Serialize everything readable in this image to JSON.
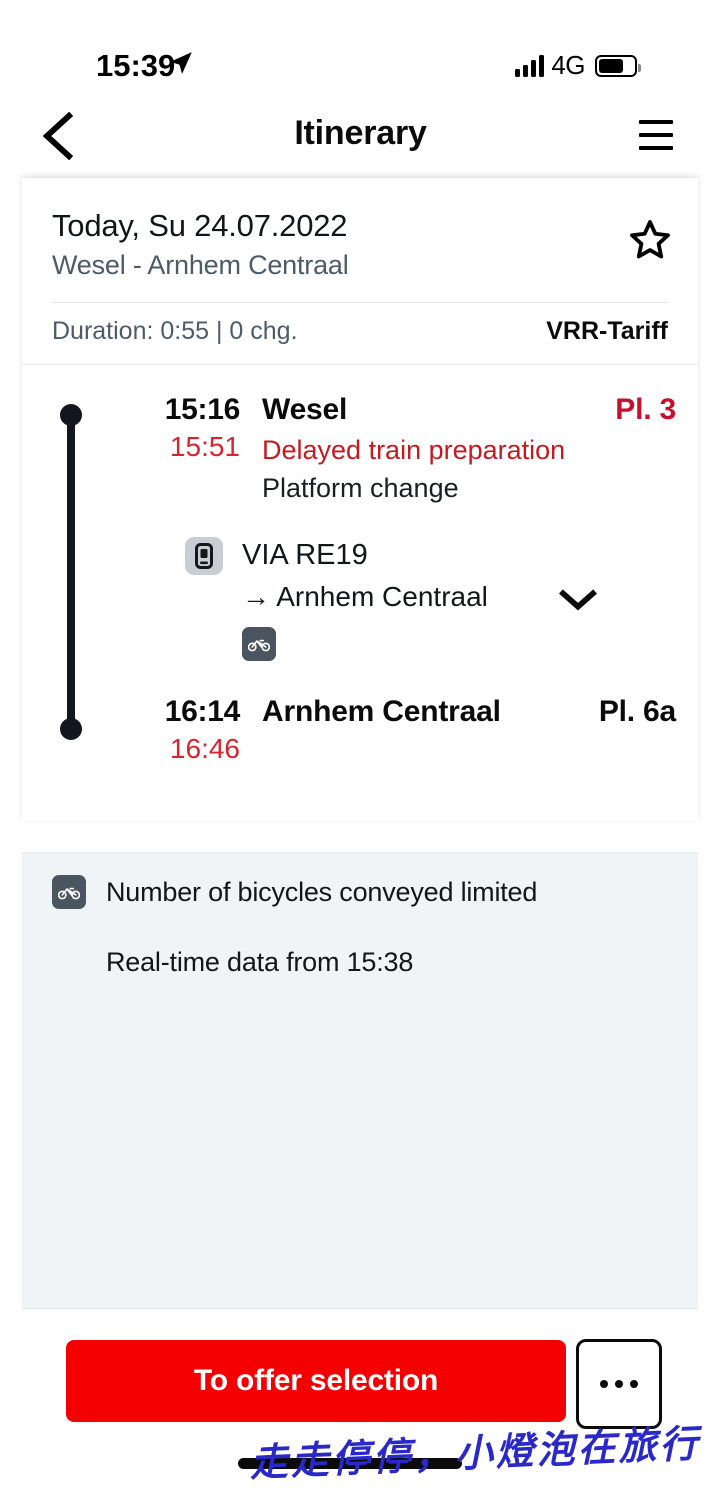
{
  "status_bar": {
    "time": "15:39",
    "location_icon": "location-arrow-icon",
    "network": "4G",
    "battery_level_pct": 62,
    "signal_bars": 4
  },
  "navbar": {
    "back_icon": "chevron-left-icon",
    "title": "Itinerary",
    "menu_icon": "hamburger-menu-icon"
  },
  "trip": {
    "date": "Today, Su 24.07.2022",
    "route": "Wesel - Arnhem Centraal",
    "favorite_icon": "star-outline-icon",
    "duration": "Duration: 0:55 | 0 chg.",
    "tariff": "VRR-Tariff"
  },
  "journey": {
    "departure": {
      "scheduled_time": "15:16",
      "realtime_time": "15:51",
      "station": "Wesel",
      "platform": "Pl. 3",
      "platform_delayed": true,
      "notes": [
        {
          "text": "Delayed train preparation",
          "style": "delay"
        },
        {
          "text": "Platform change",
          "style": "plain"
        }
      ]
    },
    "service": {
      "mode_icon": "train-mobile-icon",
      "line": "VIA RE19",
      "destination": "→ Arnhem Centraal",
      "expand_icon": "chevron-down-icon",
      "amenity_icon": "bicycle-icon"
    },
    "arrival": {
      "scheduled_time": "16:14",
      "realtime_time": "16:46",
      "station": "Arnhem Centraal",
      "platform": "Pl. 6a",
      "platform_delayed": false
    }
  },
  "info_panel": {
    "bicycle_icon": "bicycle-icon",
    "bicycle_note": "Number of bicycles conveyed limited",
    "realtime_note": "Real-time data from 15:38"
  },
  "actions": {
    "primary_label": "To offer selection",
    "more_icon": "ellipsis-icon"
  },
  "watermark": {
    "text": "走走停停，小燈泡在旅行"
  },
  "colors": {
    "accent_red": "#f50000",
    "delay_red": "#c8102e",
    "panel_bg": "#f1f4f6",
    "rail": "#14161f",
    "badge_dark": "#4a5560",
    "badge_light": "#c9ced5",
    "watermark_blue": "#2a29c8"
  }
}
